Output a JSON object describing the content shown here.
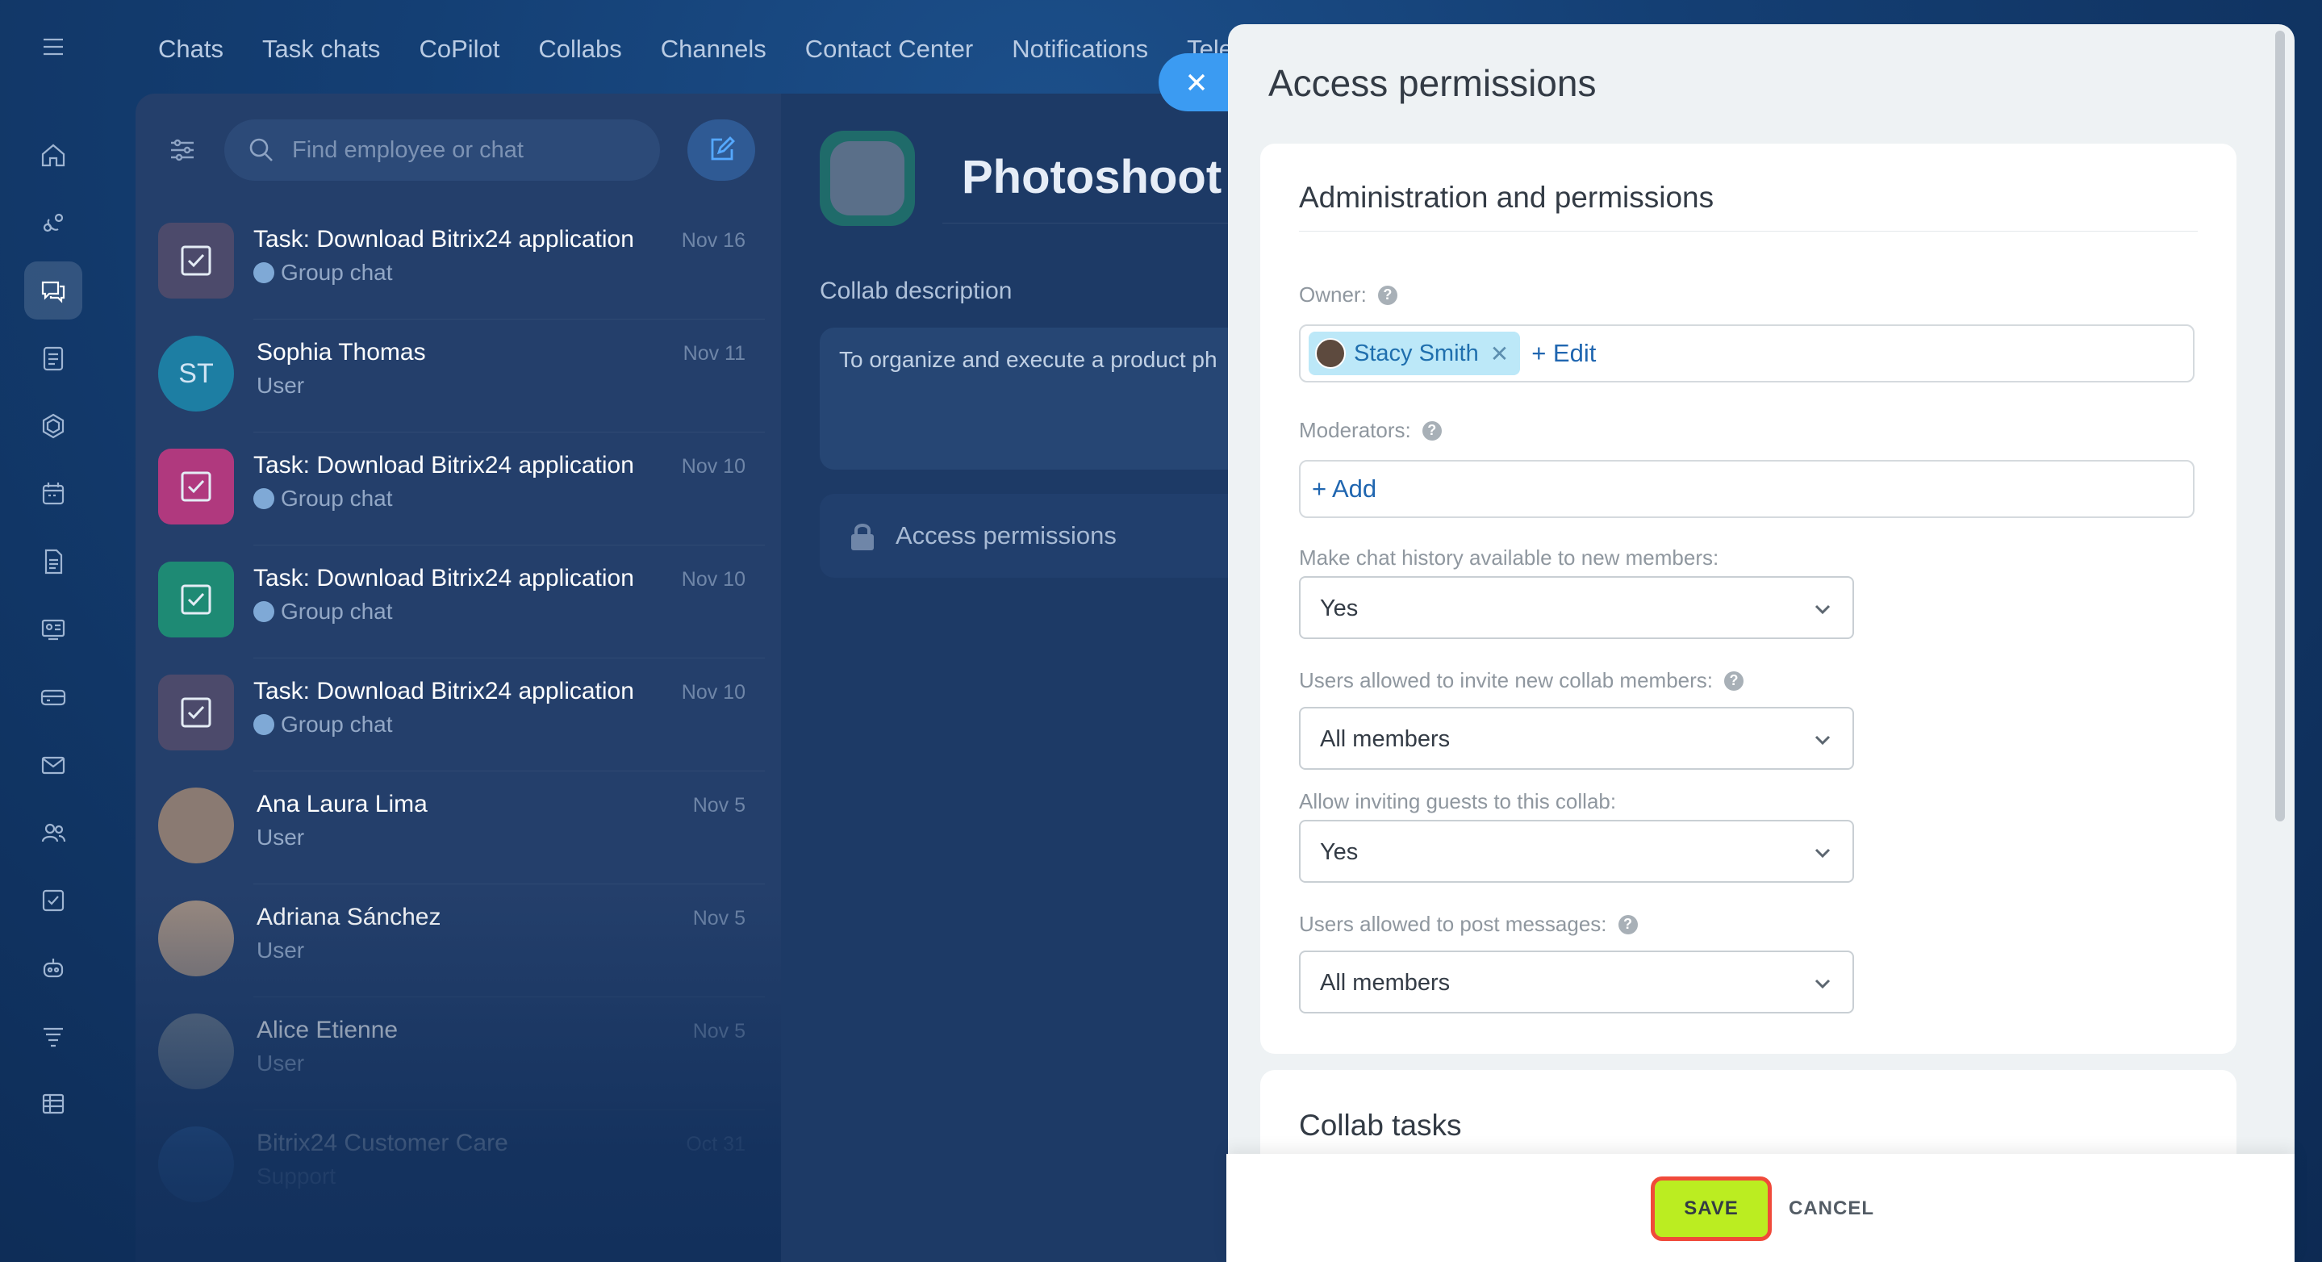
{
  "top_nav": {
    "items": [
      "Chats",
      "Task chats",
      "CoPilot",
      "Collabs",
      "Channels",
      "Contact Center",
      "Notifications",
      "Tele"
    ]
  },
  "left_rail": {
    "icons": [
      "menu-icon",
      "home-icon",
      "feed-icon",
      "messenger-icon",
      "tasks-icon",
      "hexagon-icon",
      "calendar-icon",
      "documents-icon",
      "webinar-icon",
      "crm-icon",
      "mail-icon",
      "employees-icon",
      "check-icon",
      "robot-icon",
      "filter-icon",
      "table-icon"
    ]
  },
  "chat_list": {
    "search_placeholder": "Find employee or chat",
    "items": [
      {
        "title": "Task: Download Bitrix24 application",
        "subtitle": "Group chat",
        "date": "Nov 16",
        "avatar_color": "#4c4a6b",
        "type": "task"
      },
      {
        "title": "Sophia Thomas",
        "subtitle": "User",
        "date": "Nov 11",
        "avatar_initials": "ST",
        "avatar_color": "#1d7ea3",
        "type": "user"
      },
      {
        "title": "Task: Download Bitrix24 application",
        "subtitle": "Group chat",
        "date": "Nov 10",
        "avatar_color": "#b0397e",
        "type": "task"
      },
      {
        "title": "Task: Download Bitrix24 application",
        "subtitle": "Group chat",
        "date": "Nov 10",
        "avatar_color": "#1e8a74",
        "type": "task"
      },
      {
        "title": "Task: Download Bitrix24 application",
        "subtitle": "Group chat",
        "date": "Nov 10",
        "avatar_color": "#4c4a6b",
        "type": "task"
      },
      {
        "title": "Ana Laura Lima",
        "subtitle": "User",
        "date": "Nov 5",
        "avatar_color": "#8a7a72",
        "type": "user"
      },
      {
        "title": "Adriana Sánchez",
        "subtitle": "User",
        "date": "Nov 5",
        "avatar_color": "#9a8a80",
        "type": "user"
      },
      {
        "title": "Alice Etienne",
        "subtitle": "User",
        "date": "Nov 5",
        "avatar_color": "#6e7a88",
        "type": "user"
      },
      {
        "title": "Bitrix24 Customer Care",
        "subtitle": "Support",
        "date": "Oct 31",
        "avatar_color": "#3b6fb0",
        "type": "user"
      }
    ]
  },
  "collab": {
    "title": "Photoshoot C",
    "description_label": "Collab description",
    "description_text": "To organize and execute a product ph",
    "access_permissions_label": "Access permissions"
  },
  "slider": {
    "title": "Access permissions",
    "section_title": "Administration and permissions",
    "owner_label": "Owner:",
    "owner_name": "Stacy Smith",
    "owner_edit": "+ Edit",
    "moderators_label": "Moderators:",
    "moderators_add": "+ Add",
    "history_label": "Make chat history available to new members:",
    "history_value": "Yes",
    "invite_label": "Users allowed to invite new collab members:",
    "invite_value": "All members",
    "guests_label": "Allow inviting guests to this collab:",
    "guests_value": "Yes",
    "post_label": "Users allowed to post messages:",
    "post_value": "All members",
    "tasks_section_title": "Collab tasks",
    "save_label": "SAVE",
    "cancel_label": "CANCEL"
  }
}
